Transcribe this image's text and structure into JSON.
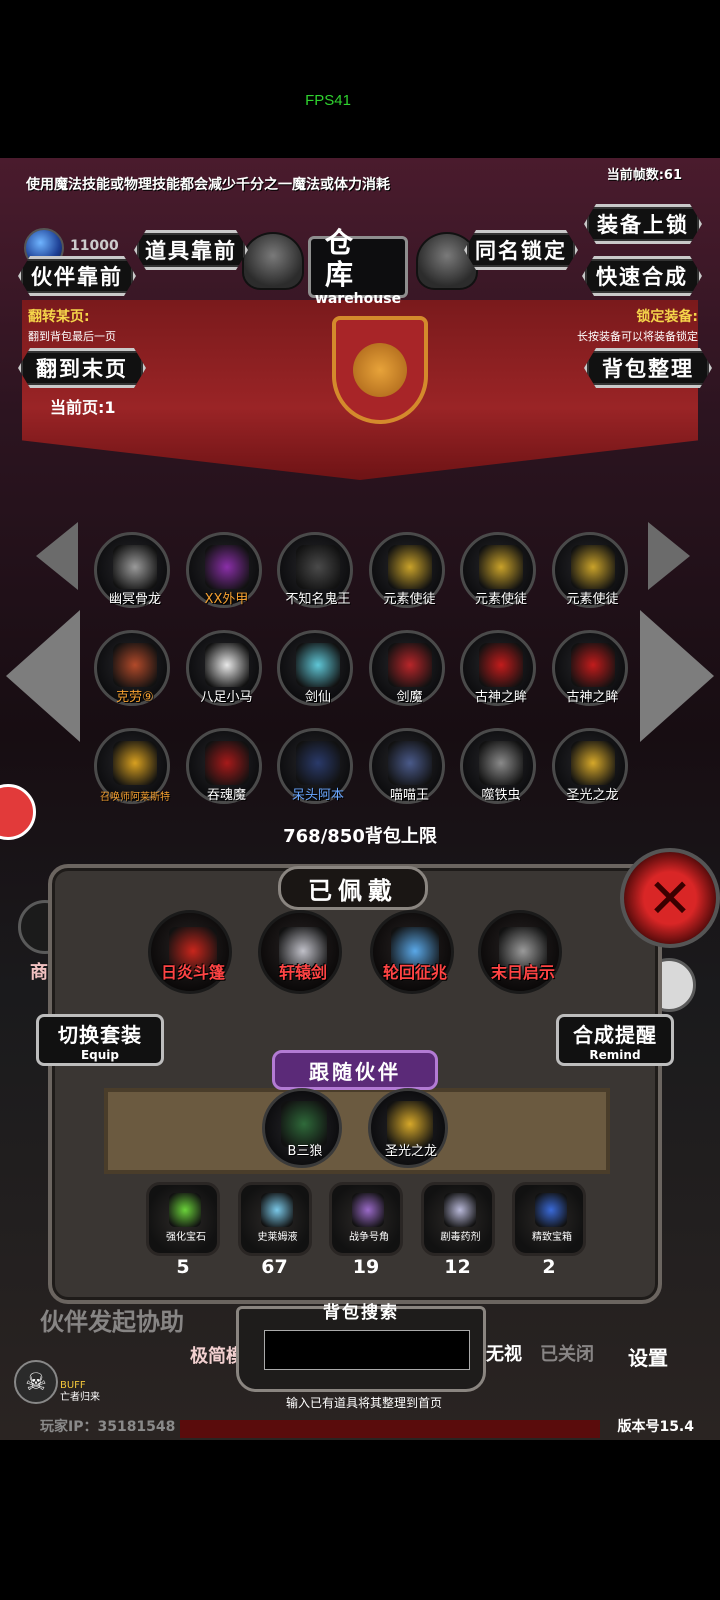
{
  "fps_overlay": "FPS41",
  "top_tip": "使用魔法技能或物理技能都会减少千分之一魔法或体力消耗",
  "frame_rate_label": "当前帧数:61",
  "gem_count": "11000",
  "buttons": {
    "items_front": "道具靠前",
    "name_lock": "同名锁定",
    "equip_lock": "装备上锁",
    "partner_front": "伙伴靠前",
    "quick_merge": "快速合成",
    "go_last_page": "翻到末页",
    "bag_sort": "背包整理"
  },
  "title": {
    "cn": "仓库",
    "en": "warehouse"
  },
  "flip_page": {
    "label": "翻转某页:",
    "desc": "翻到背包最后一页"
  },
  "lock_equip": {
    "label": "锁定装备:",
    "desc": "长按装备可以将装备锁定"
  },
  "current_page": "当前页:1",
  "warehouse_items": [
    {
      "name": "幽冥骨龙",
      "color": "#9a9a9a",
      "style": ""
    },
    {
      "name": "XX外甲",
      "color": "#8a2fa8",
      "style": "orange"
    },
    {
      "name": "不知名鬼王",
      "color": "#4a4a4a",
      "style": ""
    },
    {
      "name": "元素使徒",
      "color": "#c9a22a",
      "style": ""
    },
    {
      "name": "元素使徒",
      "color": "#c9a22a",
      "style": ""
    },
    {
      "name": "元素使徒",
      "color": "#c9a22a",
      "style": ""
    },
    {
      "name": "克劳⑨",
      "color": "#b24a2a",
      "style": "orange"
    },
    {
      "name": "八足小马",
      "color": "#e8e8e8",
      "style": ""
    },
    {
      "name": "剑仙",
      "color": "#5fc6d6",
      "style": ""
    },
    {
      "name": "剑魔",
      "color": "#b8262a",
      "style": ""
    },
    {
      "name": "古神之眸",
      "color": "#c21c1c",
      "style": ""
    },
    {
      "name": "古神之眸",
      "color": "#c21c1c",
      "style": ""
    },
    {
      "name": "召唤师阿莱斯特",
      "color": "#d8a020",
      "style": "orange small"
    },
    {
      "name": "吞魂魔",
      "color": "#a61a1a",
      "style": ""
    },
    {
      "name": "呆头阿本",
      "color": "#2a3a6a",
      "style": "blue"
    },
    {
      "name": "喵喵王",
      "color": "#4a5a8a",
      "style": ""
    },
    {
      "name": "噬铁虫",
      "color": "#8a8a8a",
      "style": ""
    },
    {
      "name": "圣光之龙",
      "color": "#d6a82a",
      "style": ""
    }
  ],
  "capacity": "768/850背包上限",
  "equipped": {
    "title": "已佩戴",
    "items": [
      {
        "name": "日炎斗篷",
        "color": "#c8261c"
      },
      {
        "name": "轩辕剑",
        "color": "#c0c0c8"
      },
      {
        "name": "轮回征兆",
        "color": "#5aa8e8"
      },
      {
        "name": "末日启示",
        "color": "#9a9a9a"
      }
    ]
  },
  "switch_set": {
    "cn": "切换套装",
    "en": "Equip"
  },
  "merge_remind": {
    "cn": "合成提醒",
    "en": "Remind"
  },
  "follow": {
    "title": "跟随伙伴",
    "pets": [
      {
        "name": "B三狼",
        "color": "#2f6a3a"
      },
      {
        "name": "圣光之龙",
        "color": "#d6a82a"
      }
    ]
  },
  "consumables": [
    {
      "name": "强化宝石",
      "count": "5",
      "color": "#6ad23a"
    },
    {
      "name": "史莱姆液",
      "count": "67",
      "color": "#7ac8e8"
    },
    {
      "name": "战争号角",
      "count": "19",
      "color": "#9a6ac8"
    },
    {
      "name": "剧毒药剂",
      "count": "12",
      "color": "#b8b8d8"
    },
    {
      "name": "精致宝箱",
      "count": "2",
      "color": "#3a6ad8"
    }
  ],
  "search": {
    "title": "背包搜索",
    "value": "",
    "hint": "输入已有道具将其整理到首页"
  },
  "background": {
    "partner_help": "伙伴发起协助",
    "simple": "极简模",
    "ignore": "无视",
    "closed": "已关闭",
    "settings": "设置",
    "shop": "商"
  },
  "buff": {
    "label": "BUFF",
    "sub": "亡者归来"
  },
  "player_ip": "玩家IP：35181548",
  "version": "版本号15.4"
}
